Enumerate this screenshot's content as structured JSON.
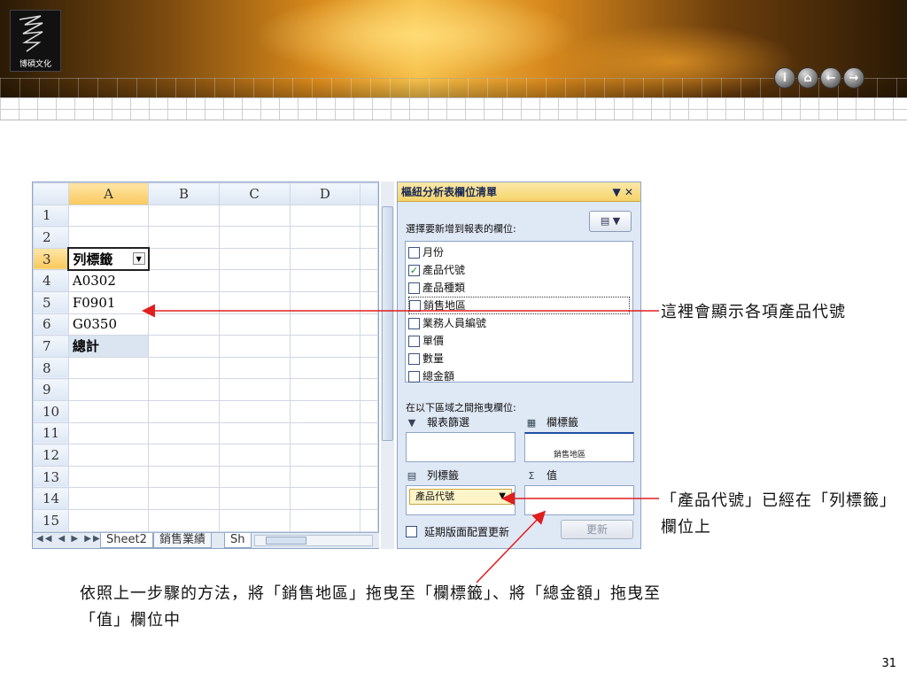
{
  "header": {
    "logo_text": "博碩文化",
    "nav": [
      "i",
      "⌂",
      "←",
      "→"
    ]
  },
  "sheet": {
    "columns": [
      "A",
      "B",
      "C",
      "D"
    ],
    "rows": [
      "1",
      "2",
      "3",
      "4",
      "5",
      "6",
      "7",
      "8",
      "9",
      "10",
      "11",
      "12",
      "13",
      "14",
      "15"
    ],
    "cells": {
      "a3": "列標籤",
      "a4": "A0302",
      "a5": "F0901",
      "a6": "G0350",
      "a7": "總計"
    },
    "tabs": [
      "Sheet2",
      "銷售業績",
      "Sh"
    ]
  },
  "pivot": {
    "title": "樞紐分析表欄位清單",
    "subtitle": "選擇要新增到報表的欄位:",
    "fields": [
      {
        "label": "月份",
        "checked": false
      },
      {
        "label": "產品代號",
        "checked": true
      },
      {
        "label": "產品種類",
        "checked": false
      },
      {
        "label": "銷售地區",
        "checked": false
      },
      {
        "label": "業務人員編號",
        "checked": false
      },
      {
        "label": "單價",
        "checked": false
      },
      {
        "label": "數量",
        "checked": false
      },
      {
        "label": "總金額",
        "checked": false
      }
    ],
    "areas_title": "在以下區域之間拖曳欄位:",
    "filter_label": "報表篩選",
    "columns_label": "欄標籤",
    "rows_label": "列標籤",
    "values_label": "值",
    "row_chip": "產品代號",
    "drag_ghost": "銷售地區",
    "defer_label": "延期版面配置更新",
    "update_label": "更新"
  },
  "notes": {
    "n1": "這裡會顯示各項產品代號",
    "n2": "「產品代號」已經在「列標籤」欄位上",
    "n3": "依照上一步驟的方法，將「銷售地區」拖曳至「欄標籤」、將「總金額」拖曳至「值」欄位中"
  },
  "page_number": "31"
}
